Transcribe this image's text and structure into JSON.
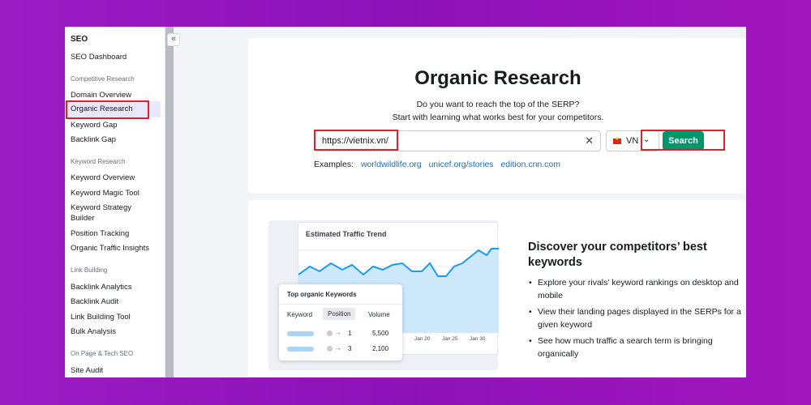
{
  "sidebar": {
    "title": "SEO",
    "dashboard": "SEO Dashboard",
    "sections": [
      {
        "label": "Competitive Research",
        "items": [
          "Domain Overview",
          "Organic Research",
          "Keyword Gap",
          "Backlink Gap"
        ]
      },
      {
        "label": "Keyword Research",
        "items": [
          "Keyword Overview",
          "Keyword Magic Tool",
          "Keyword Strategy Builder",
          "Position Tracking",
          "Organic Traffic Insights"
        ]
      },
      {
        "label": "Link Building",
        "items": [
          "Backlink Analytics",
          "Backlink Audit",
          "Link Building Tool",
          "Bulk Analysis"
        ]
      },
      {
        "label": "On Page & Tech SEO",
        "items": [
          "Site Audit"
        ]
      }
    ],
    "collapse_icon": "«"
  },
  "search": {
    "title": "Organic Research",
    "subtitle_1": "Do you want to reach the top of the SERP?",
    "subtitle_2": "Start with learning what works best for your competitors.",
    "input_value": "https://vietnix.vn/",
    "clear_icon": "✕",
    "database": "VN",
    "search_label": "Search",
    "examples_label": "Examples:",
    "examples": [
      "worldwildlife.org",
      "unicef.org/stories",
      "edition.cnn.com"
    ]
  },
  "illustration": {
    "trend_title": "Estimated Traffic Trend",
    "x_labels": [
      "Jan 20",
      "Jan 25",
      "Jan 30"
    ],
    "keywords_title": "Top organic Keywords",
    "columns": [
      "Keyword",
      "Position",
      "Volume"
    ],
    "rows": [
      {
        "position": "1",
        "volume": "5,500"
      },
      {
        "position": "3",
        "volume": "2,100"
      }
    ]
  },
  "promo": {
    "title": "Discover your competitors’ best keywords",
    "bullets": [
      "Explore your rivals' keyword rankings on desktop and mobile",
      "View their landing pages displayed in the SERPs for a given keyword",
      "See how much traffic a search term is bringing organically"
    ]
  },
  "colors": {
    "accent": "#00956a",
    "highlight": "#e0202a",
    "link": "#1b6ec2"
  }
}
